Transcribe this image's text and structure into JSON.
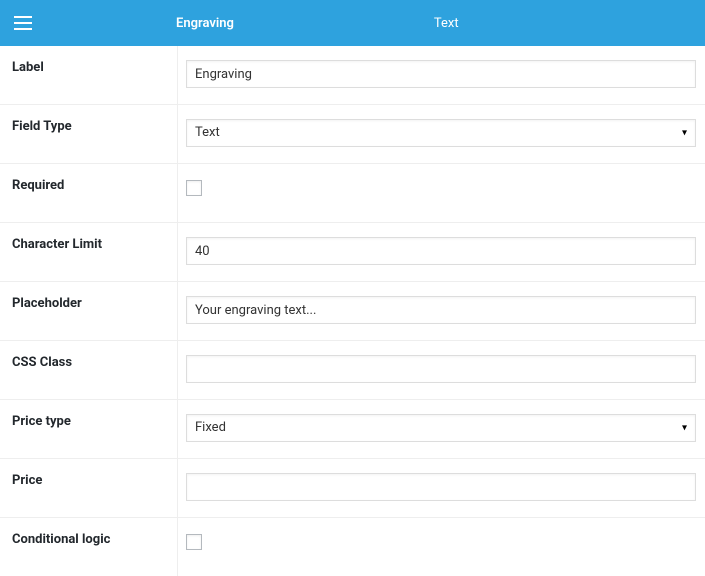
{
  "header": {
    "title": "Engraving",
    "type": "Text"
  },
  "fields": {
    "label": {
      "name": "Label",
      "value": "Engraving"
    },
    "field_type": {
      "name": "Field Type",
      "value": "Text"
    },
    "required": {
      "name": "Required",
      "checked": false
    },
    "character_limit": {
      "name": "Character Limit",
      "value": "40"
    },
    "placeholder": {
      "name": "Placeholder",
      "value": "Your engraving text..."
    },
    "css_class": {
      "name": "CSS Class",
      "value": ""
    },
    "price_type": {
      "name": "Price type",
      "value": "Fixed"
    },
    "price": {
      "name": "Price",
      "value": ""
    },
    "conditional_logic": {
      "name": "Conditional logic",
      "checked": false
    }
  }
}
